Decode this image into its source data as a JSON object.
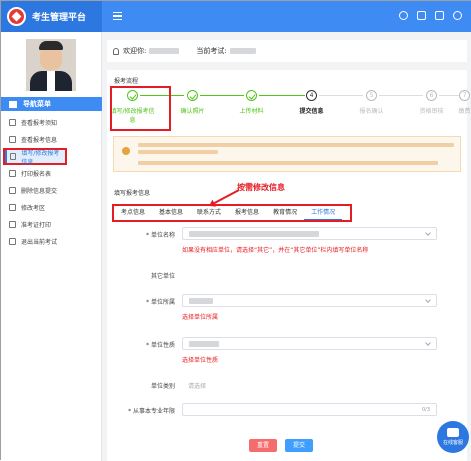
{
  "app": {
    "title": "考生管理平台"
  },
  "sidebar": {
    "menu_header": "导航菜单",
    "items": [
      {
        "label": "查看报考须知",
        "icon": "document-icon"
      },
      {
        "label": "查看报考信息",
        "icon": "document-icon"
      },
      {
        "label": "填写/修改报考信息",
        "icon": "edit-icon"
      },
      {
        "label": "打印报名表",
        "icon": "print-icon"
      },
      {
        "label": "删除信息提交",
        "icon": "delete-icon"
      },
      {
        "label": "修改考区",
        "icon": "refresh-icon"
      },
      {
        "label": "准考证打印",
        "icon": "print-icon"
      },
      {
        "label": "退出当前考试",
        "icon": "exit-icon"
      }
    ]
  },
  "welcome": {
    "greeting": "欢迎你:",
    "exam_label": "当前考试:"
  },
  "process": {
    "title": "报考流程",
    "steps": [
      {
        "label": "填写/修改报考信息",
        "state": "done",
        "num": ""
      },
      {
        "label": "确认照片",
        "state": "done",
        "num": ""
      },
      {
        "label": "上传材料",
        "state": "done",
        "num": ""
      },
      {
        "label": "提交信息",
        "state": "current",
        "num": "4"
      },
      {
        "label": "报名确认",
        "state": "todo",
        "num": "5"
      },
      {
        "label": "资格审核",
        "state": "todo",
        "num": "6"
      },
      {
        "label": "缴费",
        "state": "todo",
        "num": "7"
      }
    ]
  },
  "form": {
    "title": "填写报考信息",
    "annotation": "按需修改信息",
    "tabs": [
      "考点信息",
      "基本信息",
      "联系方式",
      "报考信息",
      "教育情况",
      "工作情况"
    ],
    "active_tab": 5,
    "fields": {
      "unit_name": {
        "label": "* 单位名称",
        "hint": "如果没有相应单位，请选择“其它”，并在“其它单位”栏内填写单位名称"
      },
      "other_unit": {
        "label": "其它单位"
      },
      "unit_affil": {
        "label": "* 单位所属",
        "error": "选择单位所属"
      },
      "unit_nature": {
        "label": "* 单位性质",
        "error": "选择单位性质"
      },
      "unit_type": {
        "label": "单位类别",
        "placeholder": "请选择"
      },
      "years": {
        "label": "* 从事本专业年限",
        "counter": "0/3"
      }
    },
    "reset": "重置",
    "submit": "提交"
  },
  "chat": {
    "label": "在线客服"
  },
  "colors": {
    "primary": "#3f8bf4",
    "highlight": "#e51c23",
    "success": "#52c41a"
  }
}
